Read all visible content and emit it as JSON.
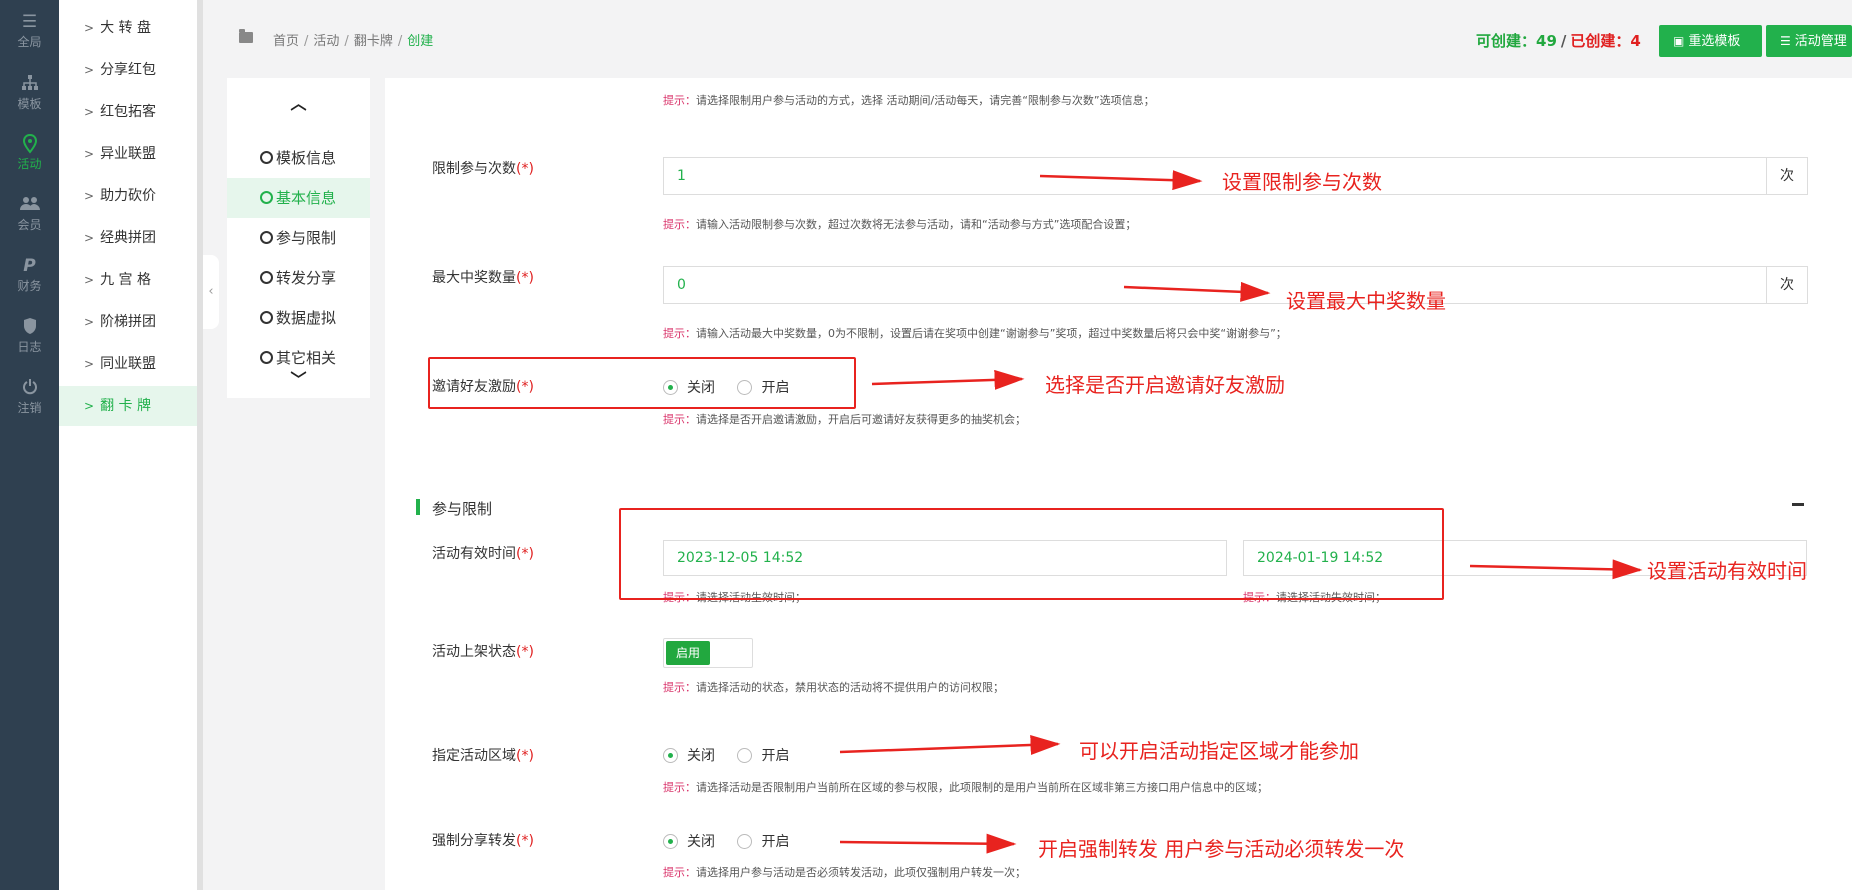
{
  "rail": {
    "items": [
      {
        "label": "全局",
        "icon": "sliders-icon"
      },
      {
        "label": "模板",
        "icon": "sitemap-icon"
      },
      {
        "label": "活动",
        "icon": "activity-pin-icon"
      },
      {
        "label": "会员",
        "icon": "users-icon"
      },
      {
        "label": "财务",
        "icon": "paypal-icon"
      },
      {
        "label": "日志",
        "icon": "shield-icon"
      },
      {
        "label": "注销",
        "icon": "power-icon"
      }
    ],
    "active": "活动"
  },
  "submenu": {
    "items": [
      "大 转 盘",
      "分享红包",
      "红包拓客",
      "异业联盟",
      "助力砍价",
      "经典拼团",
      "九 宫 格",
      "阶梯拼团",
      "同业联盟",
      "翻 卡 牌"
    ],
    "active": "翻 卡 牌"
  },
  "breadcrumb": {
    "items": [
      "首页",
      "活动",
      "翻卡牌"
    ],
    "current": "创建",
    "separator": "/"
  },
  "header": {
    "can_create_label": "可创建：",
    "can_create_value": "49",
    "slash": "/",
    "created_label": "已创建：",
    "created_value": "4",
    "reselect_button": "重选模板",
    "manage_button": "活动管理"
  },
  "stepnav": {
    "steps": [
      "模板信息",
      "基本信息",
      "参与限制",
      "转发分享",
      "数据虚拟",
      "其它相关"
    ],
    "active": "基本信息"
  },
  "form": {
    "required_mark": "(*)",
    "tip_key": "提示：",
    "participation_mode_tip": "请选择限制用户参与活动的方式，选择 活动期间/活动每天，请完善“限制参与次数”选项信息；",
    "limit_times": {
      "label": "限制参与次数",
      "value": "1",
      "unit": "次",
      "tip": "请输入活动限制参与次数，超过次数将无法参与活动，请和“活动参与方式”选项配合设置；"
    },
    "max_prizes": {
      "label": "最大中奖数量",
      "value": "0",
      "unit": "次",
      "tip": "请输入活动最大中奖数量，0为不限制，设置后请在奖项中创建“谢谢参与”奖项，超过中奖数量后将只会中奖“谢谢参与”；"
    },
    "invite_reward": {
      "label": "邀请好友激励",
      "options": [
        "关闭",
        "开启"
      ],
      "selected": "关闭",
      "tip": "请选择是否开启邀请激励，开启后可邀请好友获得更多的抽奖机会；"
    },
    "section_title": "参与限制",
    "valid_time": {
      "label": "活动有效时间",
      "start": "2023-12-05 14:52",
      "end": "2024-01-19 14:52",
      "start_tip": "请选择活动生效时间；",
      "end_tip": "请选择活动失效时间；"
    },
    "shelf_status": {
      "label": "活动上架状态",
      "toggle_label": "启用",
      "enabled": true,
      "tip": "请选择活动的状态，禁用状态的活动将不提供用户的访问权限；"
    },
    "region": {
      "label": "指定活动区域",
      "options": [
        "关闭",
        "开启"
      ],
      "selected": "关闭",
      "tip": "请选择活动是否限制用户当前所在区域的参与权限，此项限制的是用户当前所在区域非第三方接口用户信息中的区域；"
    },
    "force_share": {
      "label": "强制分享转发",
      "options": [
        "关闭",
        "开启"
      ],
      "selected": "关闭",
      "tip": "请选择用户参与活动是否必须转发活动，此项仅强制用户转发一次；"
    }
  },
  "annotations": {
    "limit_times": "设置限制参与次数",
    "max_prizes": "设置最大中奖数量",
    "invite_reward": "选择是否开启邀请好友激励",
    "valid_time": "设置活动有效时间",
    "region": "可以开启活动指定区域才能参加",
    "force_share": "开启强制转发 用户参与活动必须转发一次",
    "color": "#e8231f"
  },
  "colors": {
    "accent": "#22b14c",
    "rail": "#2f4050",
    "danger": "#e02020"
  }
}
